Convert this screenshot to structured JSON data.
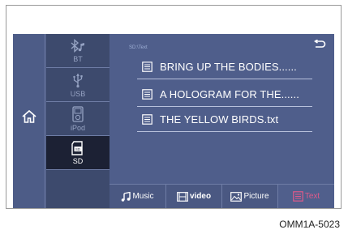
{
  "sources": [
    {
      "label": "BT",
      "icon": "bluetooth-music-icon",
      "active": false
    },
    {
      "label": "USB",
      "icon": "usb-icon",
      "active": false
    },
    {
      "label": "iPod",
      "icon": "ipod-icon",
      "active": false
    },
    {
      "label": "SD",
      "icon": "sd-card-icon",
      "active": true
    }
  ],
  "path": "SD:\\Text",
  "files": [
    {
      "name": "BRING UP THE BODIES......",
      "icon": "text-file-icon"
    },
    {
      "name": "A HOLOGRAM FOR THE......",
      "icon": "text-file-icon"
    },
    {
      "name": "THE YELLOW BIRDS.txt",
      "icon": "text-file-icon"
    }
  ],
  "tabs": [
    {
      "label": "Music",
      "icon": "music-note-icon",
      "active": false
    },
    {
      "label": "video",
      "icon": "film-icon",
      "active": false
    },
    {
      "label": "Picture",
      "icon": "picture-icon",
      "active": false
    },
    {
      "label": "Text",
      "icon": "text-doc-icon",
      "active": true
    }
  ],
  "caption": "OMM1A-5023",
  "colors": {
    "accent": "#e05a8a",
    "screen_bg": "#4f5e8b",
    "active_source_bg": "#1c2134"
  }
}
